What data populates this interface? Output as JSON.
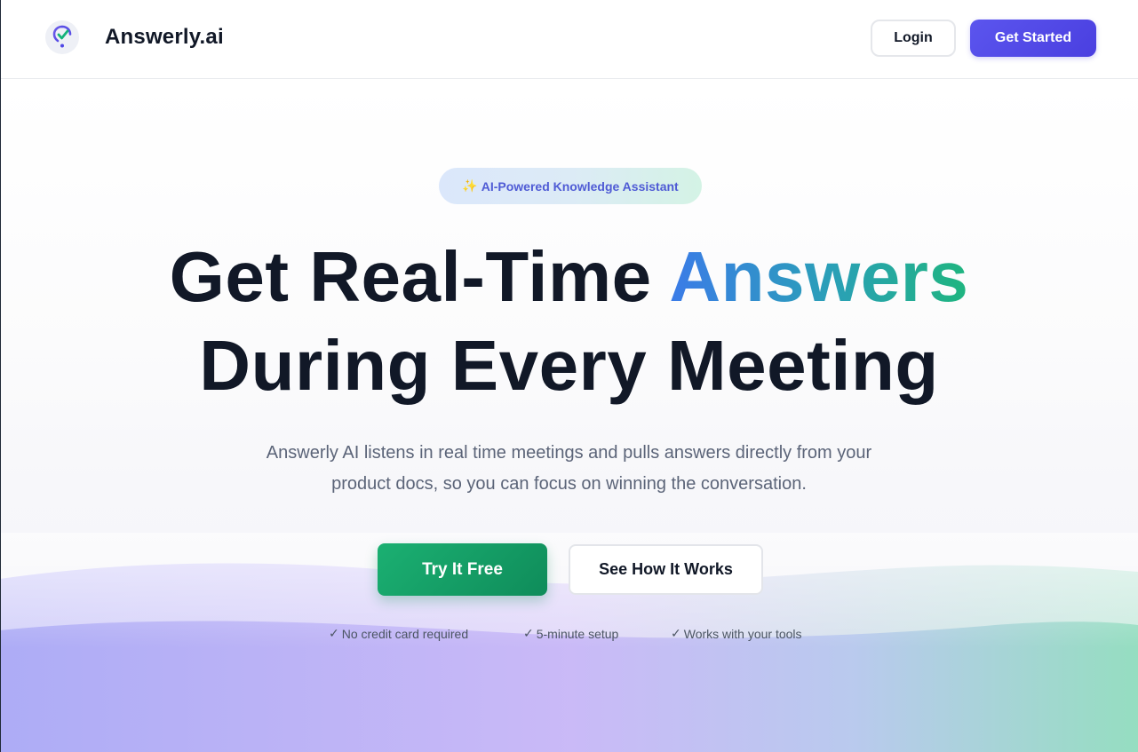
{
  "header": {
    "brand": "Answerly.ai",
    "login_label": "Login",
    "get_started_label": "Get Started"
  },
  "hero": {
    "badge_icon": "✨",
    "badge_text": "AI-Powered Knowledge Assistant",
    "headline_prefix": "Get Real-Time ",
    "headline_accent": "Answers",
    "headline_line2": "During Every Meeting",
    "subtitle_line1": "Answerly AI listens in real time meetings and pulls answers directly from your",
    "subtitle_line2": "product docs, so you can focus on winning the conversation.",
    "primary_cta": "Try It Free",
    "secondary_cta": "See How It Works",
    "perks": [
      "No credit card required",
      "5-minute setup",
      "Works with your tools"
    ],
    "perk_check": "✓"
  },
  "colors": {
    "primary": "#4f46e5",
    "accent_green": "#10a56a",
    "text_dark": "#111827",
    "text_muted": "#5b6478"
  },
  "icons": {
    "logo": "location-pin-check-icon",
    "badge": "sparkles-icon",
    "perk": "checkmark-icon"
  }
}
